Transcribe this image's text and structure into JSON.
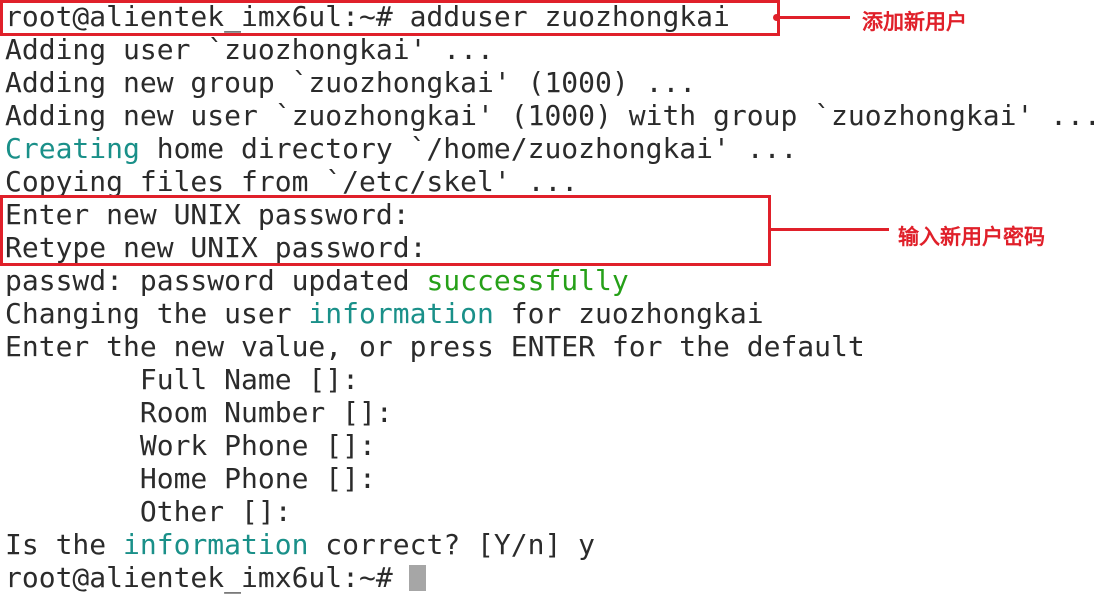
{
  "terminal": {
    "lines": [
      {
        "segments": [
          {
            "text": "root@alientek_imx6ul:~# adduser zuozhongkai"
          }
        ]
      },
      {
        "segments": [
          {
            "text": "Adding user `zuozhongkai' ..."
          }
        ]
      },
      {
        "segments": [
          {
            "text": "Adding new group `zuozhongkai' (1000) ..."
          }
        ]
      },
      {
        "segments": [
          {
            "text": "Adding new user `zuozhongkai' (1000) with group `zuozhongkai' ..."
          }
        ]
      },
      {
        "segments": [
          {
            "text": "Creating",
            "color": "teal"
          },
          {
            "text": " home directory `/home/zuozhongkai' ..."
          }
        ]
      },
      {
        "segments": [
          {
            "text": "Copying files from `/etc/skel' ..."
          }
        ]
      },
      {
        "segments": [
          {
            "text": "Enter new UNIX password:"
          }
        ]
      },
      {
        "segments": [
          {
            "text": "Retype new UNIX password:"
          }
        ]
      },
      {
        "segments": [
          {
            "text": "passwd: password updated "
          },
          {
            "text": "successfully",
            "color": "green"
          }
        ]
      },
      {
        "segments": [
          {
            "text": "Changing the user "
          },
          {
            "text": "information",
            "color": "teal"
          },
          {
            "text": " for zuozhongkai"
          }
        ]
      },
      {
        "segments": [
          {
            "text": "Enter the new value, or press ENTER for the default"
          }
        ]
      },
      {
        "segments": [
          {
            "text": "        Full Name []:"
          }
        ]
      },
      {
        "segments": [
          {
            "text": "        Room Number []:"
          }
        ]
      },
      {
        "segments": [
          {
            "text": "        Work Phone []:"
          }
        ]
      },
      {
        "segments": [
          {
            "text": "        Home Phone []:"
          }
        ]
      },
      {
        "segments": [
          {
            "text": "        Other []:"
          }
        ]
      },
      {
        "segments": [
          {
            "text": "Is the "
          },
          {
            "text": "information",
            "color": "teal"
          },
          {
            "text": " correct? [Y/n] y"
          }
        ]
      },
      {
        "segments": [
          {
            "text": "root@alientek_imx6ul:~#"
          }
        ],
        "cursor": true
      }
    ]
  },
  "annotations": {
    "add_user_label": "添加新用户",
    "password_label": "输入新用户密码"
  },
  "colors": {
    "annotation": "#e0202a",
    "green": "#26a018",
    "teal": "#1a9089",
    "text": "#2b2b2b",
    "cursor": "#a6a6a6"
  }
}
